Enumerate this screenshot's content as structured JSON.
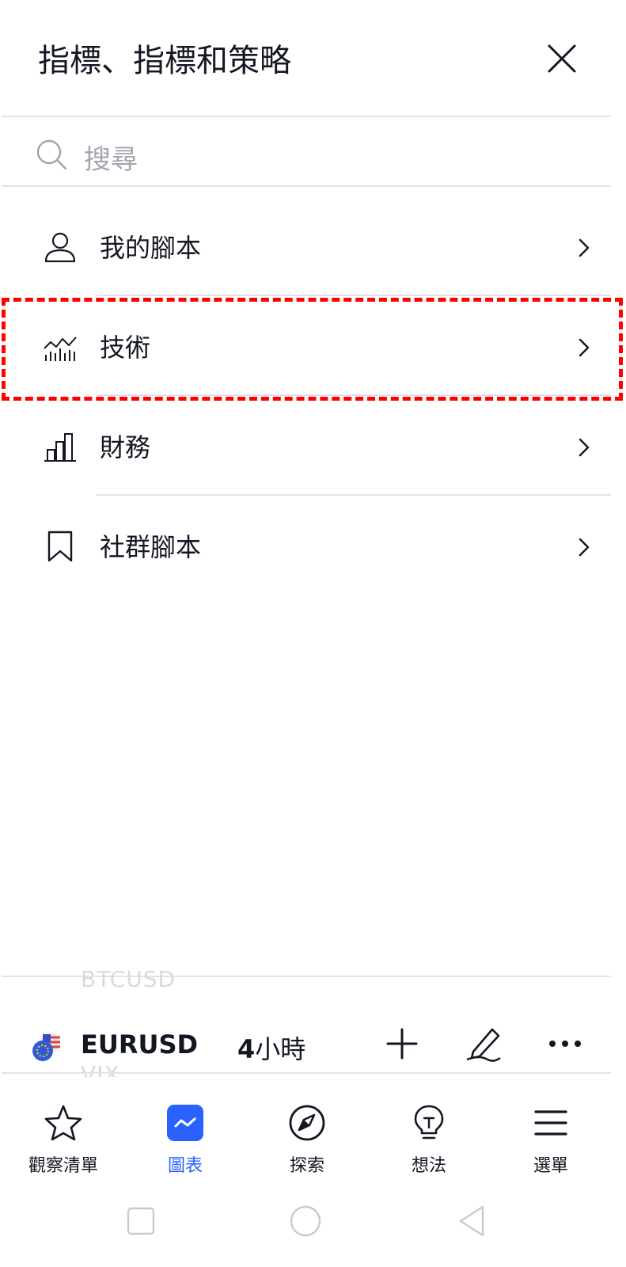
{
  "header": {
    "title": "指標、指標和策略",
    "close_icon": "close-icon"
  },
  "search": {
    "placeholder": "搜尋",
    "icon": "search-icon"
  },
  "menu": {
    "items": [
      {
        "label": "我的腳本",
        "icon": "user-icon"
      },
      {
        "label": "技術",
        "icon": "technical-chart-icon",
        "highlighted": true
      },
      {
        "label": "財務",
        "icon": "bar-chart-icon"
      },
      {
        "label": "社群腳本",
        "icon": "bookmark-icon"
      }
    ]
  },
  "ticker_bar": {
    "prev_symbol": "BTCUSD",
    "symbol": "EURUSD",
    "next_symbol": "VIX",
    "timeframe_num": "4",
    "timeframe_unit": "小時",
    "tools": [
      "plus-icon",
      "pen-icon",
      "more-icon"
    ]
  },
  "tabbar": {
    "tabs": [
      {
        "label": "觀察清單",
        "icon": "star-icon"
      },
      {
        "label": "圖表",
        "icon": "chart-icon",
        "active": true
      },
      {
        "label": "探索",
        "icon": "compass-icon"
      },
      {
        "label": "想法",
        "icon": "lightbulb-icon"
      },
      {
        "label": "選單",
        "icon": "menu-icon"
      }
    ]
  },
  "colors": {
    "accent": "#2962ff",
    "text": "#131722",
    "divider": "#e0e3eb",
    "highlight": "#ff0000"
  }
}
